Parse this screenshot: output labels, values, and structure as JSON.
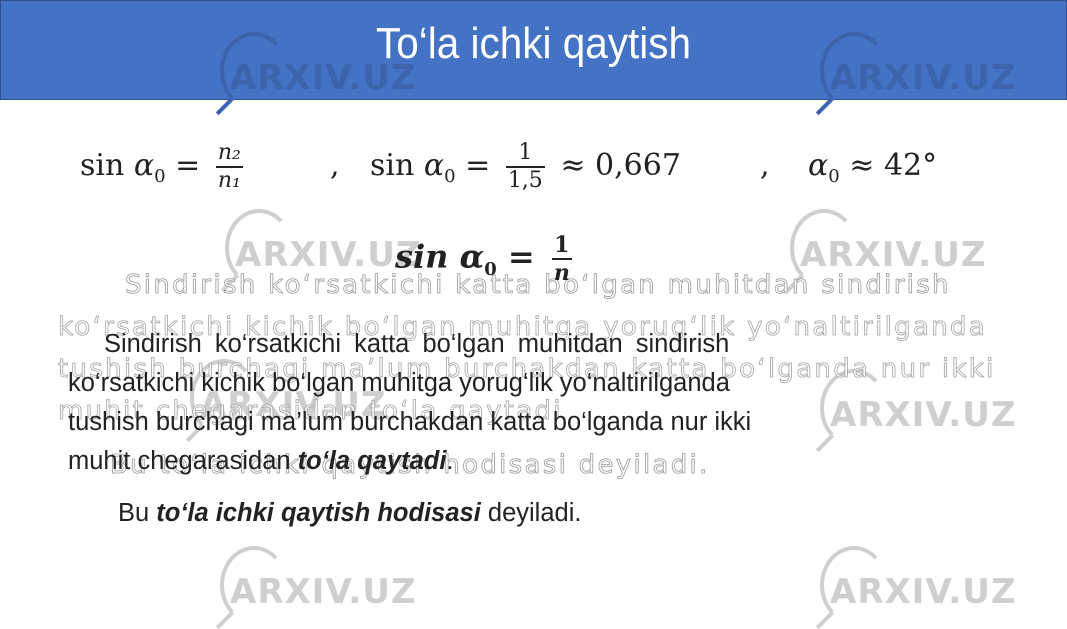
{
  "title": "To‘la ichki qaytish",
  "watermark": "ARXIV.UZ",
  "colors": {
    "title_bar": "#4472c4",
    "title_text": "#ffffff",
    "body_text": "#222222"
  },
  "formulas": {
    "f1_lhs": "sin",
    "f1_var": "α",
    "f1_sub": "0",
    "f1_eq": "=",
    "f1_num": "n₂",
    "f1_den": "n₁",
    "sep1": ",",
    "f2_lhs": "sin",
    "f2_var": "α",
    "f2_sub": "0",
    "f2_eq": "=",
    "f2_num": "1",
    "f2_den": "1,5",
    "f2_approx": "≈ 0,667",
    "sep2": ",",
    "f3_var": "α",
    "f3_sub": "0",
    "f3_approx": "≈ 42°",
    "main_lhs": "sin",
    "main_var": "α",
    "main_sub": "0",
    "main_eq": "=",
    "main_num": "1",
    "main_den": "n"
  },
  "ghost_lines": [
    "Sindirish ko‘rsatkichi katta bo‘lgan muhitdan sindirish",
    "ko‘rsatkichi kichik bo‘lgan muhitga yorug‘lik yo‘naltirilganda",
    "tushish burchagi ma’lum burchakdan katta bo‘lganda nur ikki",
    "muhit chegarasidan to‘la qaytadi",
    "Bu to‘la ichki qaytish hodisasi deyiladi."
  ],
  "paragraph": {
    "line1": "Sindirish  ko‘rsatkichi  katta  bo‘lgan  muhitdan  sindirish",
    "line2": "ko‘rsatkichi kichik bo‘lgan muhitga yorug‘lik yo‘naltirilganda",
    "line3": "tushish burchagi ma’lum burchakdan katta bo‘lganda nur ikki",
    "line4_plain": "muhit chegarasidan ",
    "line4_emph": "to‘la qaytadi",
    "line4_end": "."
  },
  "conclusion": {
    "prefix": "Bu ",
    "emph": "to‘la ichki qaytish hodisasi",
    "suffix": " deyiladi."
  }
}
